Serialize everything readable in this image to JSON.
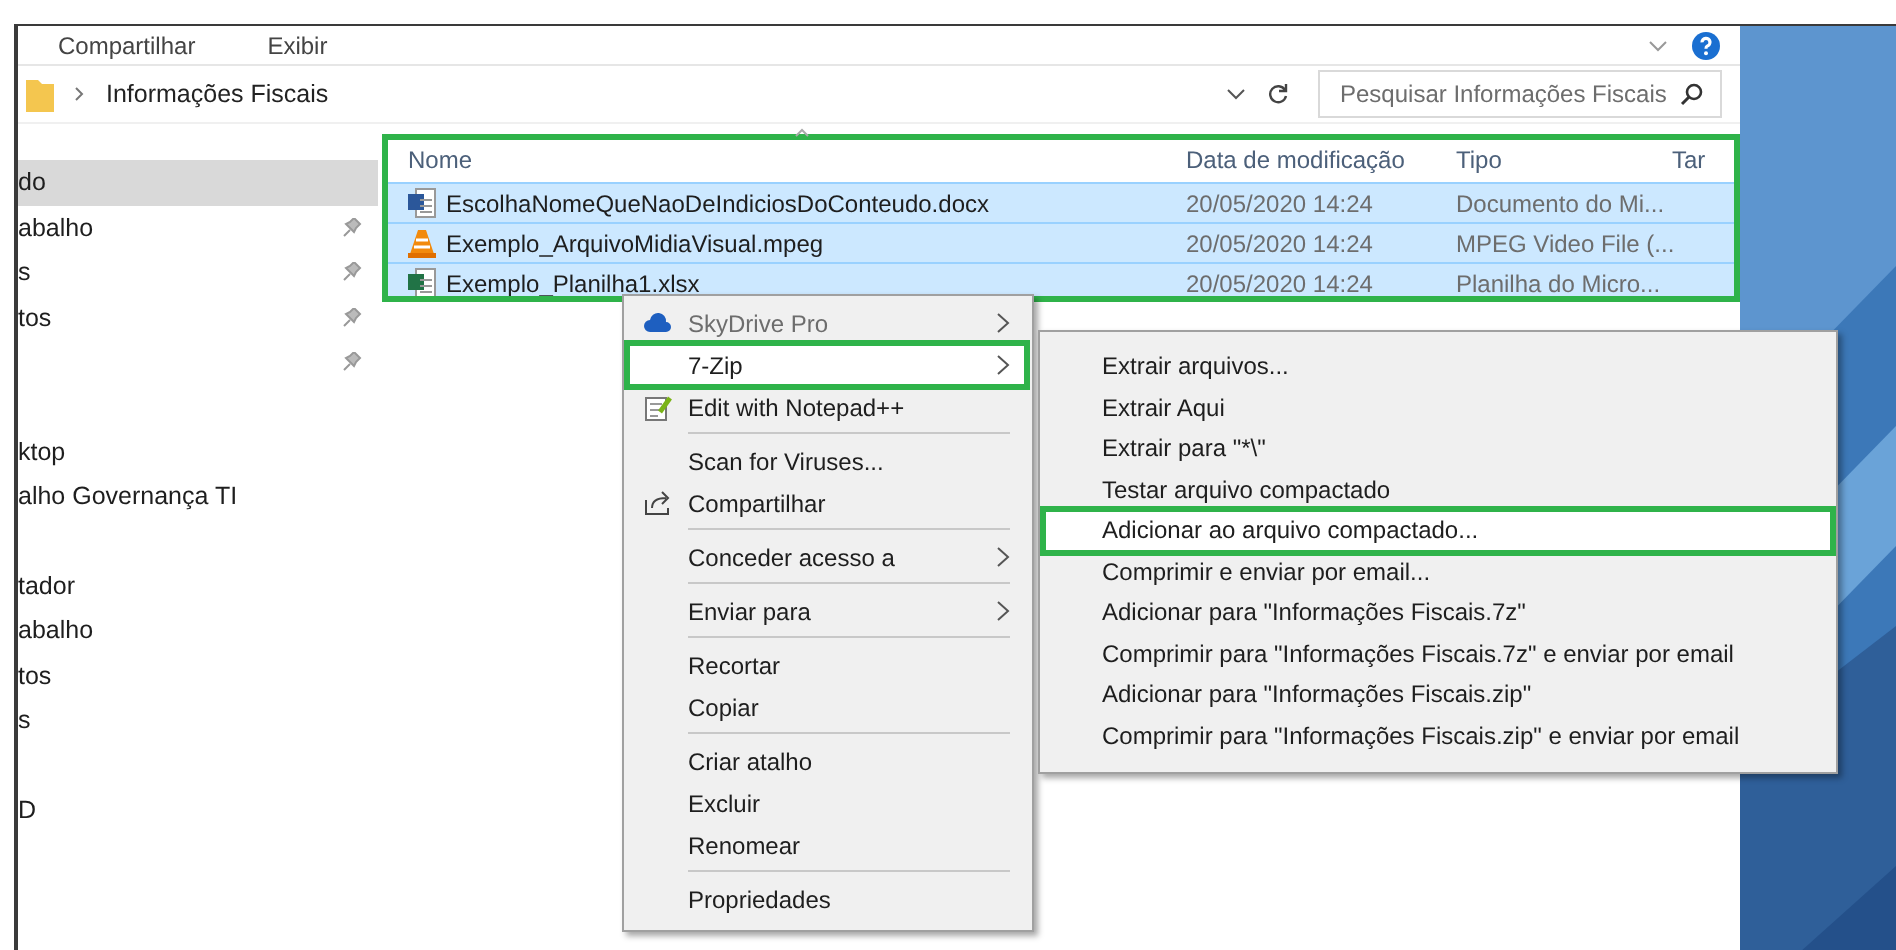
{
  "ribbon": {
    "tabs": [
      {
        "label": "Compartilhar"
      },
      {
        "label": "Exibir"
      }
    ]
  },
  "address": {
    "path": "Informações Fiscais",
    "search": {
      "placeholder": "Pesquisar Informações Fiscais"
    }
  },
  "sidebar": {
    "groups": [
      {
        "items": [
          {
            "label": "do",
            "selected": true,
            "pinned": false
          },
          {
            "label": "abalho",
            "selected": false,
            "pinned": true
          },
          {
            "label": "s",
            "selected": false,
            "pinned": true
          },
          {
            "label": "tos",
            "selected": false,
            "pinned": true
          },
          {
            "selected": false,
            "pinned": true
          }
        ]
      },
      {
        "items": [
          {
            "label": "ktop",
            "selected": false,
            "pinned": false
          },
          {
            "label": "alho Governança TI",
            "selected": false,
            "pinned": false
          }
        ]
      },
      {
        "items": [
          {
            "label": "tador",
            "selected": false,
            "pinned": false
          },
          {
            "label": "abalho",
            "selected": false,
            "pinned": false
          },
          {
            "label": "tos",
            "selected": false,
            "pinned": false
          },
          {
            "label": "s",
            "selected": false,
            "pinned": false
          }
        ]
      },
      {
        "items": [
          {
            "label": "D",
            "selected": false,
            "pinned": false
          }
        ]
      }
    ]
  },
  "file_list": {
    "outlined": true,
    "columns": [
      "Nome",
      "Data de modificação",
      "Tipo",
      "Tar"
    ],
    "rows": [
      {
        "kind": "document",
        "name": "EscolhaNomeQueNaoDeIndiciosDoConteudo.docx",
        "modified": "20/05/2020 14:24",
        "type": "Documento do Mi...",
        "selected": true
      },
      {
        "kind": "video",
        "name": "Exemplo_ArquivoMidiaVisual.mpeg",
        "modified": "20/05/2020 14:24",
        "type": "MPEG Video File (...",
        "selected": true
      },
      {
        "kind": "spreadsheet",
        "name": "Exemplo_Planilha1.xlsx",
        "modified": "20/05/2020 14:24",
        "type": "Planilha do Micro...",
        "selected": true
      }
    ]
  },
  "context_menu": {
    "items": [
      {
        "label": "SkyDrive Pro",
        "kind": "cloud",
        "submenu": true,
        "disabled": true,
        "selected": false,
        "outlined": false,
        "separator_after": false
      },
      {
        "label": "7-Zip",
        "submenu": true,
        "disabled": false,
        "selected": true,
        "outlined": true,
        "separator_after": false
      },
      {
        "label": "Edit with Notepad++",
        "kind": "editor",
        "submenu": false,
        "disabled": false,
        "selected": false,
        "outlined": false,
        "separator_after": true
      },
      {
        "label": "Scan for Viruses...",
        "submenu": false,
        "disabled": false,
        "selected": false,
        "outlined": false,
        "separator_after": false
      },
      {
        "label": "Compartilhar",
        "kind": "share",
        "submenu": false,
        "disabled": false,
        "selected": false,
        "outlined": false,
        "separator_after": true
      },
      {
        "label": "Conceder acesso a",
        "submenu": true,
        "disabled": false,
        "selected": false,
        "outlined": false,
        "separator_after": true
      },
      {
        "label": "Enviar para",
        "submenu": true,
        "disabled": false,
        "selected": false,
        "outlined": false,
        "separator_after": true
      },
      {
        "label": "Recortar",
        "submenu": false,
        "disabled": false,
        "selected": false,
        "outlined": false,
        "separator_after": false
      },
      {
        "label": "Copiar",
        "submenu": false,
        "disabled": false,
        "selected": false,
        "outlined": false,
        "separator_after": true
      },
      {
        "label": "Criar atalho",
        "submenu": false,
        "disabled": false,
        "selected": false,
        "outlined": false,
        "separator_after": false
      },
      {
        "label": "Excluir",
        "submenu": false,
        "disabled": false,
        "selected": false,
        "outlined": false,
        "separator_after": false
      },
      {
        "label": "Renomear",
        "submenu": false,
        "disabled": false,
        "selected": false,
        "outlined": false,
        "separator_after": true
      },
      {
        "label": "Propriedades",
        "submenu": false,
        "disabled": false,
        "selected": false,
        "outlined": false,
        "separator_after": false
      }
    ]
  },
  "submenu": {
    "items": [
      {
        "label": "Extrair arquivos...",
        "selected": false,
        "outlined": false
      },
      {
        "label": "Extrair Aqui",
        "selected": false,
        "outlined": false
      },
      {
        "label": "Extrair para \"*\\\"",
        "selected": false,
        "outlined": false
      },
      {
        "label": "Testar arquivo compactado",
        "selected": false,
        "outlined": false
      },
      {
        "label": "Adicionar ao arquivo compactado...",
        "selected": true,
        "outlined": true
      },
      {
        "label": "Comprimir e enviar por email...",
        "selected": false,
        "outlined": false
      },
      {
        "label": "Adicionar para \"Informações Fiscais.7z\"",
        "selected": false,
        "outlined": false
      },
      {
        "label": "Comprimir para \"Informações Fiscais.7z\" e enviar por email",
        "selected": false,
        "outlined": false
      },
      {
        "label": "Adicionar para \"Informações Fiscais.zip\"",
        "selected": false,
        "outlined": false
      },
      {
        "label": "Comprimir para \"Informações Fiscais.zip\" e enviar por email",
        "selected": false,
        "outlined": false
      }
    ]
  }
}
